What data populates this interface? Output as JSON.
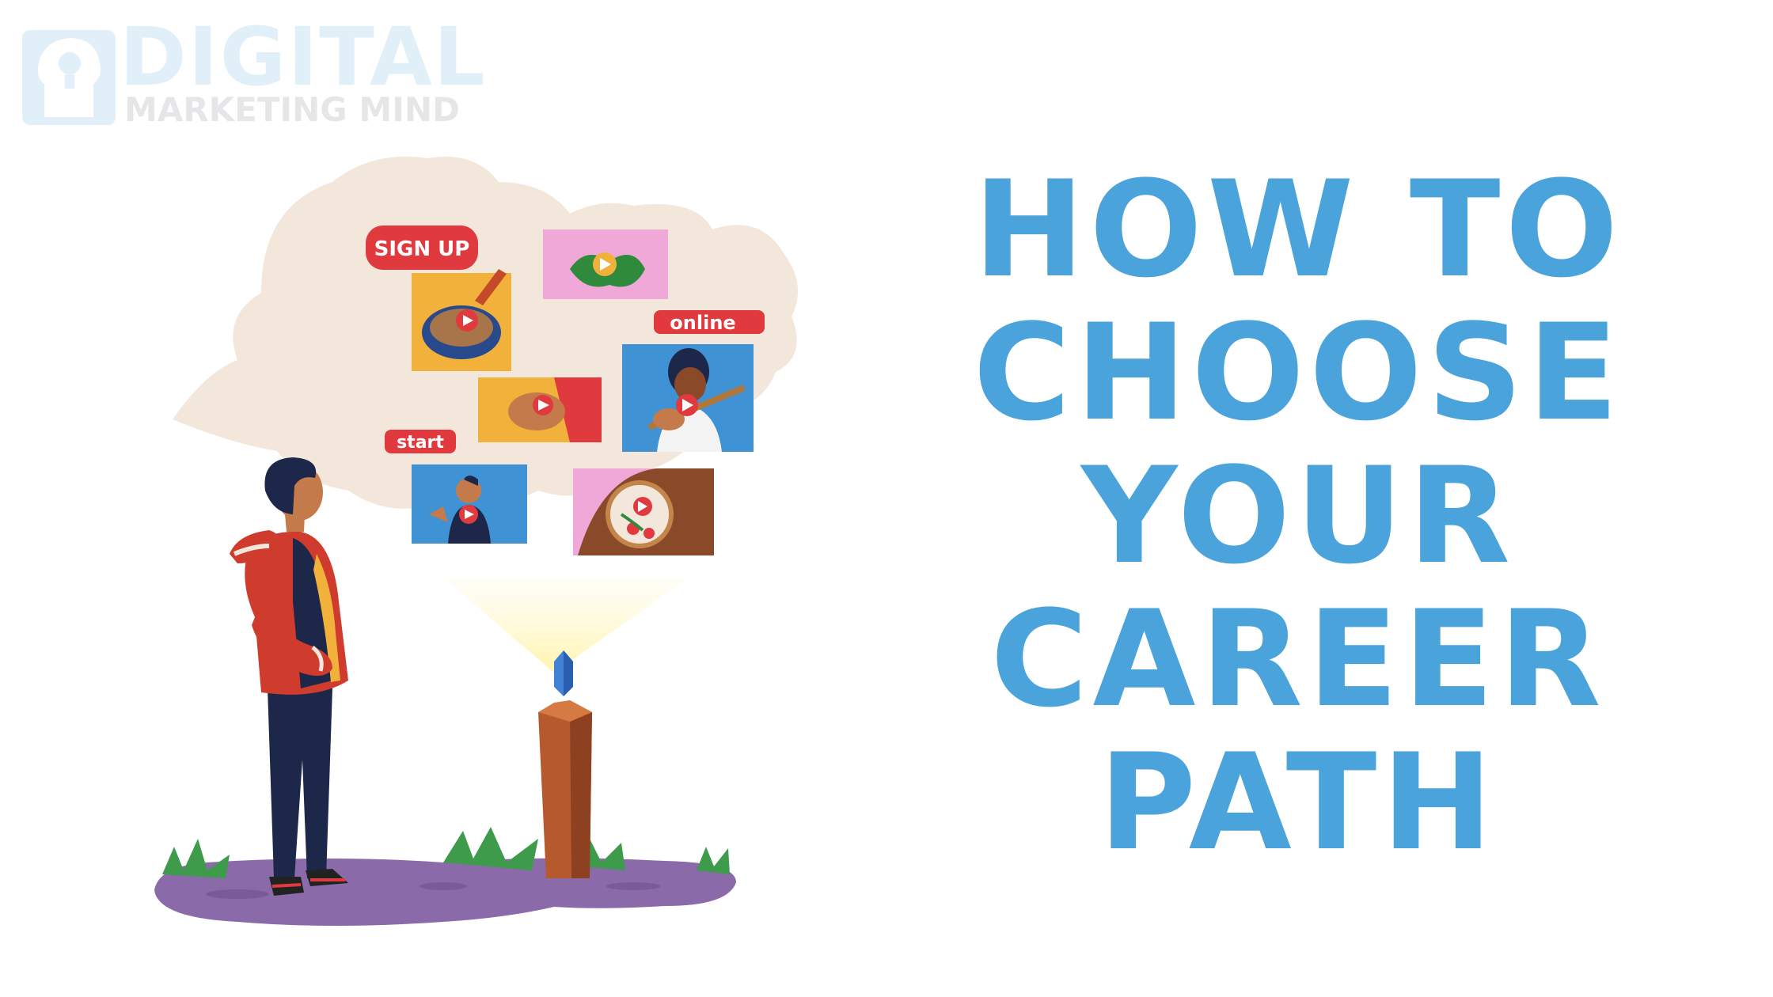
{
  "logo": {
    "line1": "DIGITAL",
    "line2": "MARKETING MIND"
  },
  "headline": {
    "lines": [
      "HOW TO",
      "CHOOSE",
      "YOUR",
      "CAREER",
      "PATH"
    ]
  },
  "illustration": {
    "signup_label": "SIGN UP",
    "online_label": "online",
    "start_label": "start"
  },
  "colors": {
    "headline_blue": "#4aa3db",
    "label_red": "#e0393e",
    "cloud": "#f3e6da",
    "ground": "#8a6aa8"
  }
}
